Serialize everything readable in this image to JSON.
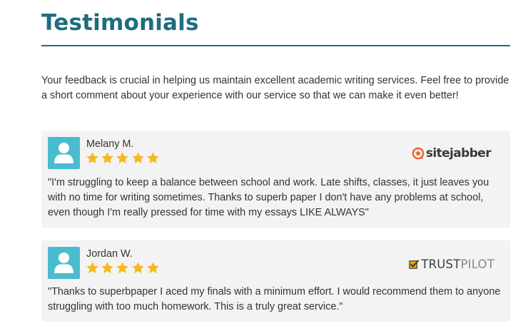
{
  "header": {
    "title": "Testimonials"
  },
  "intro": "Your feedback is crucial in helping us maintain excellent academic writing services. Feel free to provide a short comment about your experience with our service so that we can make it even better!",
  "colors": {
    "title": "#1f6d7e",
    "avatar": "#49bccd",
    "star": "#f6b820",
    "card_bg": "#f3f3f3",
    "sitejabber_accent": "#f05a22"
  },
  "testimonials": [
    {
      "name": "Melany M.",
      "rating": 5,
      "rating_max": 5,
      "source": {
        "text": "sitejabber",
        "icon": "sitejabber-logo-icon"
      },
      "quote": "\"I'm struggling to keep a balance between school and work. Late shifts, classes, it just leaves you with no time for writing sometimes. Thanks to superb paper I don't have any problems at school, even though I'm really pressed for time with my essays LIKE ALWAYS\""
    },
    {
      "name": "Jordan W.",
      "rating": 5,
      "rating_max": 5,
      "source": {
        "text_part1": "TRUST",
        "text_part2": "PILOT",
        "icon": "trustpilot-check-icon"
      },
      "quote": "\"Thanks to superbpaper I aced my finals with a minimum effort. I would recommend them to anyone struggling with too much homework. This is a truly great service.\""
    }
  ]
}
